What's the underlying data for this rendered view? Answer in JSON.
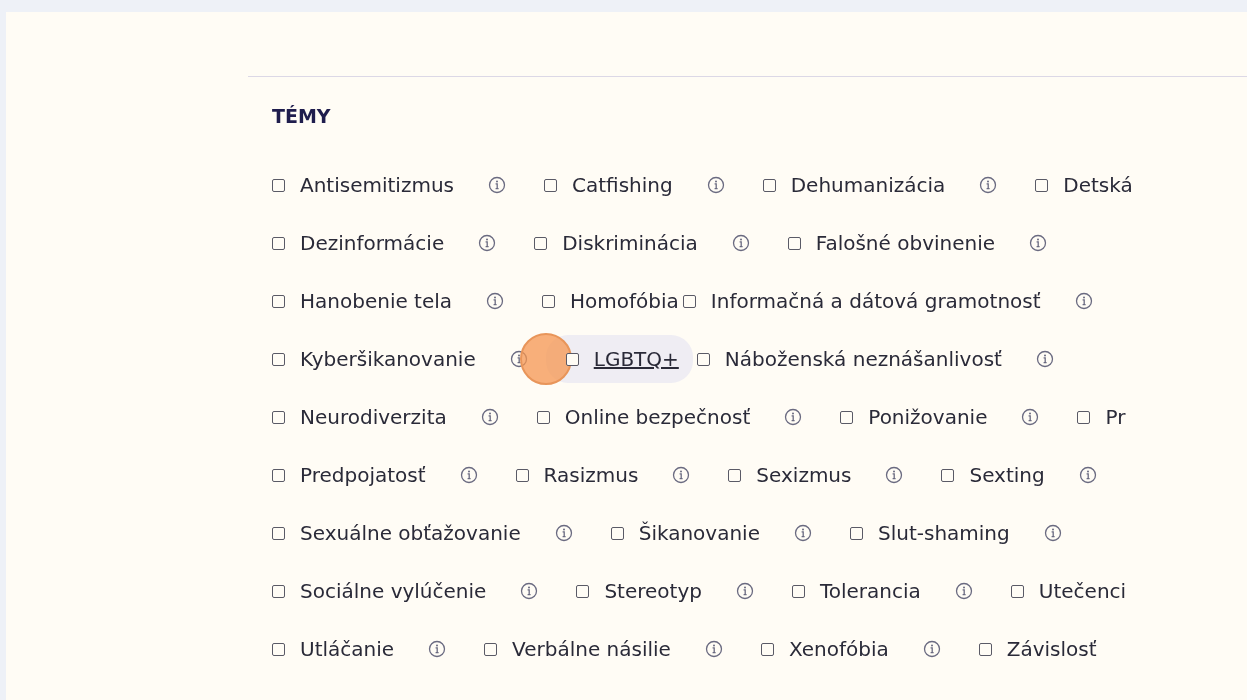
{
  "section": {
    "title": "TÉMY"
  },
  "rows": [
    [
      {
        "label": "Antisemitizmus",
        "checked": false,
        "info": true
      },
      {
        "label": "Catfishing",
        "checked": false,
        "info": true
      },
      {
        "label": "Dehumanizácia",
        "checked": false,
        "info": true
      },
      {
        "label": "Detská",
        "checked": false,
        "info": false
      }
    ],
    [
      {
        "label": "Dezinformácie",
        "checked": false,
        "info": true
      },
      {
        "label": "Diskriminácia",
        "checked": false,
        "info": true
      },
      {
        "label": "Falošné obvinenie",
        "checked": false,
        "info": true
      }
    ],
    [
      {
        "label": "Hanobenie tela",
        "checked": false,
        "info": true
      },
      {
        "label": "Homofóbia",
        "checked": false,
        "info": false
      },
      {
        "label": "Informačná a dátová gramotnosť",
        "checked": false,
        "info": true
      }
    ],
    [
      {
        "label": "Kyberšikanovanie",
        "checked": false,
        "info": true
      },
      {
        "label": "LGBTQ+",
        "checked": false,
        "info": false,
        "hovered": true
      },
      {
        "label": "Náboženská neznášanlivosť",
        "checked": false,
        "info": true
      }
    ],
    [
      {
        "label": "Neurodiverzita",
        "checked": false,
        "info": true
      },
      {
        "label": "Online bezpečnosť",
        "checked": false,
        "info": true
      },
      {
        "label": "Ponižovanie",
        "checked": false,
        "info": true
      },
      {
        "label": "Pr",
        "checked": false,
        "info": false
      }
    ],
    [
      {
        "label": "Predpojatosť",
        "checked": false,
        "info": true
      },
      {
        "label": "Rasizmus",
        "checked": false,
        "info": true
      },
      {
        "label": "Sexizmus",
        "checked": false,
        "info": true
      },
      {
        "label": "Sexting",
        "checked": false,
        "info": true
      }
    ],
    [
      {
        "label": "Sexuálne obťažovanie",
        "checked": false,
        "info": true
      },
      {
        "label": "Šikanovanie",
        "checked": false,
        "info": true
      },
      {
        "label": "Slut-shaming",
        "checked": false,
        "info": true
      }
    ],
    [
      {
        "label": "Sociálne vylúčenie",
        "checked": false,
        "info": true
      },
      {
        "label": "Stereotyp",
        "checked": false,
        "info": true
      },
      {
        "label": "Tolerancia",
        "checked": false,
        "info": true
      },
      {
        "label": "Utečenci",
        "checked": false,
        "info": false
      }
    ],
    [
      {
        "label": "Utláčanie",
        "checked": false,
        "info": true
      },
      {
        "label": "Verbálne násilie",
        "checked": false,
        "info": true
      },
      {
        "label": "Xenofóbia",
        "checked": false,
        "info": true
      },
      {
        "label": "Závislosť",
        "checked": false,
        "info": false
      }
    ]
  ]
}
